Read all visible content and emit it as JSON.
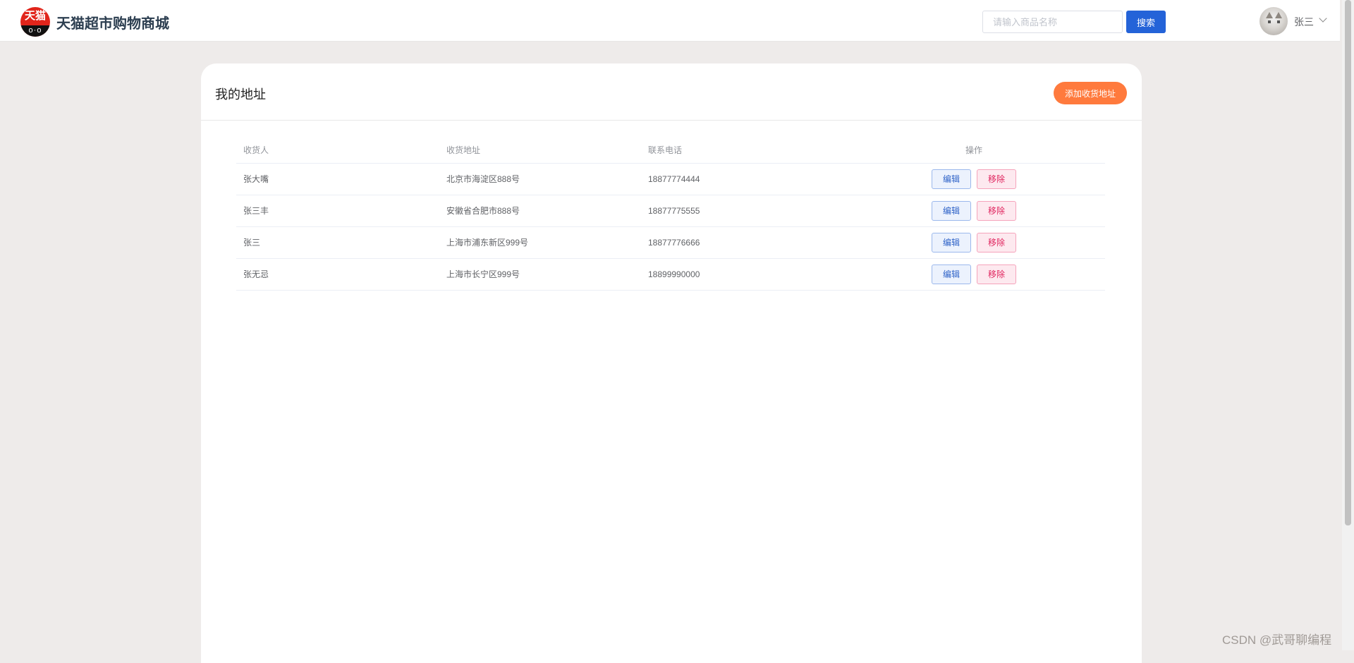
{
  "header": {
    "logo_text": "天猫",
    "logo_face": "o·o",
    "site_title": "天猫超市购物商城",
    "search_placeholder": "请输入商品名称",
    "search_button": "搜索",
    "user_name": "张三"
  },
  "page": {
    "title": "我的地址",
    "add_button": "添加收货地址"
  },
  "table": {
    "columns": {
      "recipient": "收货人",
      "address": "收货地址",
      "phone": "联系电话",
      "actions": "操作"
    },
    "edit_label": "编辑",
    "remove_label": "移除",
    "rows": [
      {
        "recipient": "张大嘴",
        "address": "北京市海淀区888号",
        "phone": "18877774444"
      },
      {
        "recipient": "张三丰",
        "address": "安徽省合肥市888号",
        "phone": "18877775555"
      },
      {
        "recipient": "张三",
        "address": "上海市浦东新区999号",
        "phone": "18877776666"
      },
      {
        "recipient": "张无忌",
        "address": "上海市长宁区999号",
        "phone": "18899990000"
      }
    ]
  },
  "watermark": "CSDN @武哥聊编程",
  "colors": {
    "primary": "#2463d8",
    "accent": "#ff7a3d",
    "danger": "#e0245e",
    "background": "#eeebea"
  }
}
